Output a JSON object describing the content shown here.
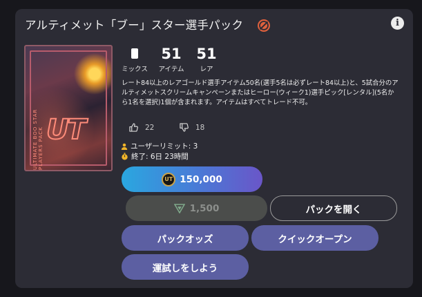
{
  "pack": {
    "title": "アルティメット「ブー」スター選手パック",
    "restriction_icon": "no-trade-icon",
    "info_icon": "info-icon",
    "art_logo": "UT",
    "art_side_text": "ULTIMATE BOO STAR PLAYERS PACK"
  },
  "stats": {
    "mix": {
      "icon": "card-icon",
      "label": "ミックス"
    },
    "items": {
      "value": "51",
      "label": "アイテム"
    },
    "rare": {
      "value": "51",
      "label": "レア"
    }
  },
  "description": "レート84以上のレアゴールド選手アイテム50名(選手5名は必ずレート84以上)と、5試合分のアルティメットスクリームキャンペーンまたはヒーロー(ウィーク1)選手ピック[レンタル](5名から1名を選択)1個が含まれます。アイテムはすべてトレード不可。",
  "votes": {
    "up": "22",
    "down": "18"
  },
  "meta": {
    "user_limit": "ユーザーリミット: 3",
    "ends": "終了: 6日 23時間"
  },
  "buttons": {
    "coins": "150,000",
    "points": "1,500",
    "open": "パックを開く",
    "odds": "パックオッズ",
    "quick_open": "クイックオープン",
    "try_luck": "運試しをしよう"
  },
  "colors": {
    "panel": "#2c2c35",
    "accent_button": "#5c5fa2",
    "coin_gradient_start": "#2aa7e0",
    "coin_gradient_end": "#6a56c8"
  }
}
